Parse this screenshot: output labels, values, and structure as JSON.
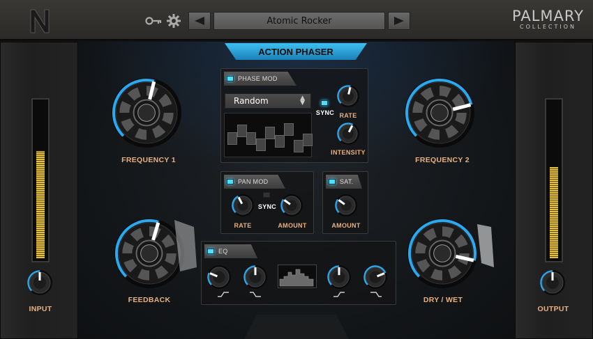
{
  "header": {
    "preset_name": "Atomic Rocker",
    "brand_line1": "PALMARY",
    "brand_line2": "COLLECTION"
  },
  "plugin_title": "ACTION PHASER",
  "left_side": {
    "knob_label": "INPUT",
    "meter_level": 0.68,
    "knob_value": 0.5
  },
  "right_side": {
    "knob_label": "OUTPUT",
    "meter_level": 0.58,
    "knob_value": 0.5
  },
  "knobs": {
    "frequency1": {
      "label": "FREQUENCY 1",
      "value": 0.55
    },
    "frequency2": {
      "label": "FREQUENCY 2",
      "value": 0.78
    },
    "feedback": {
      "label": "FEEDBACK",
      "value": 0.56
    },
    "drywet": {
      "label": "DRY / WET",
      "value": 0.88
    }
  },
  "phase_mod": {
    "title": "PHASE MOD",
    "enabled": true,
    "mode": "Random",
    "sync_label": "SYNC",
    "sync": true,
    "rate_label": "RATE",
    "rate_value": 0.55,
    "intensity_label": "INTENSITY",
    "intensity_value": 0.6,
    "sequence": [
      0.45,
      0.75,
      0.45,
      0.2,
      0.65,
      0.35,
      0.8,
      0.15,
      0.4
    ]
  },
  "pan_mod": {
    "title": "PAN MOD",
    "enabled": true,
    "sync_label": "SYNC",
    "sync": false,
    "rate_label": "RATE",
    "rate_value": 0.4,
    "amount_label": "AMOUNT",
    "amount_value": 0.3
  },
  "sat": {
    "title": "SAT.",
    "enabled": true,
    "amount_label": "AMOUNT",
    "amount_value": 0.3
  },
  "eq": {
    "title": "EQ",
    "enabled": true,
    "knob_values": [
      0.25,
      0.5,
      0.5,
      0.75
    ]
  },
  "colors": {
    "accent": "#3ec0f0",
    "label": "#e6b080",
    "meter": "#e6c03c"
  }
}
